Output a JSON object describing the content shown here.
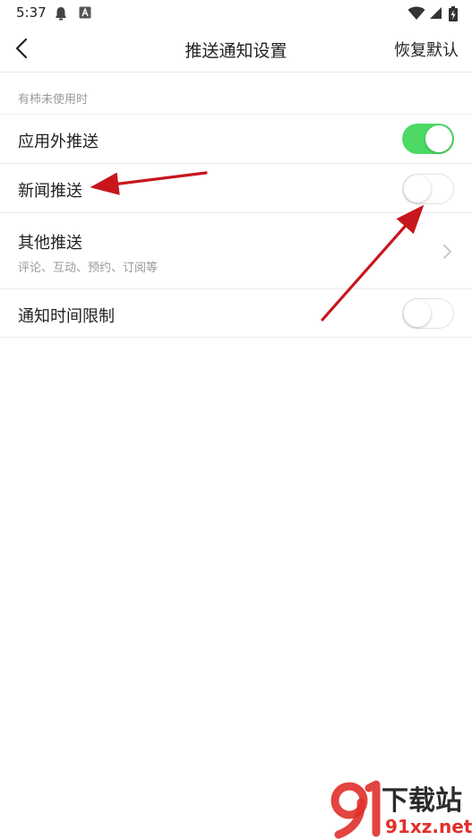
{
  "status_bar": {
    "time": "5:37",
    "left_icons": [
      "qq-bell-icon",
      "a-notification-icon"
    ],
    "right_icons": [
      "wifi-icon",
      "signal-icon",
      "battery-charging-icon"
    ]
  },
  "nav": {
    "back_icon": "back-chevron-icon",
    "title": "推送通知设置",
    "action": "恢复默认"
  },
  "section": {
    "header": "有柿未使用时"
  },
  "rows": [
    {
      "label": "应用外推送",
      "toggle": "on"
    },
    {
      "label": "新闻推送",
      "toggle": "off"
    },
    {
      "label": "其他推送",
      "subtitle": "评论、互动、预约、订阅等",
      "chevron": "chevron-right-icon"
    },
    {
      "label": "通知时间限制",
      "toggle": "off"
    }
  ],
  "colors": {
    "toggle_on": "#4cd964",
    "annotation_arrow": "#c8161d"
  },
  "watermark": {
    "logo_text": "下载站",
    "domain": "91xz.net"
  }
}
